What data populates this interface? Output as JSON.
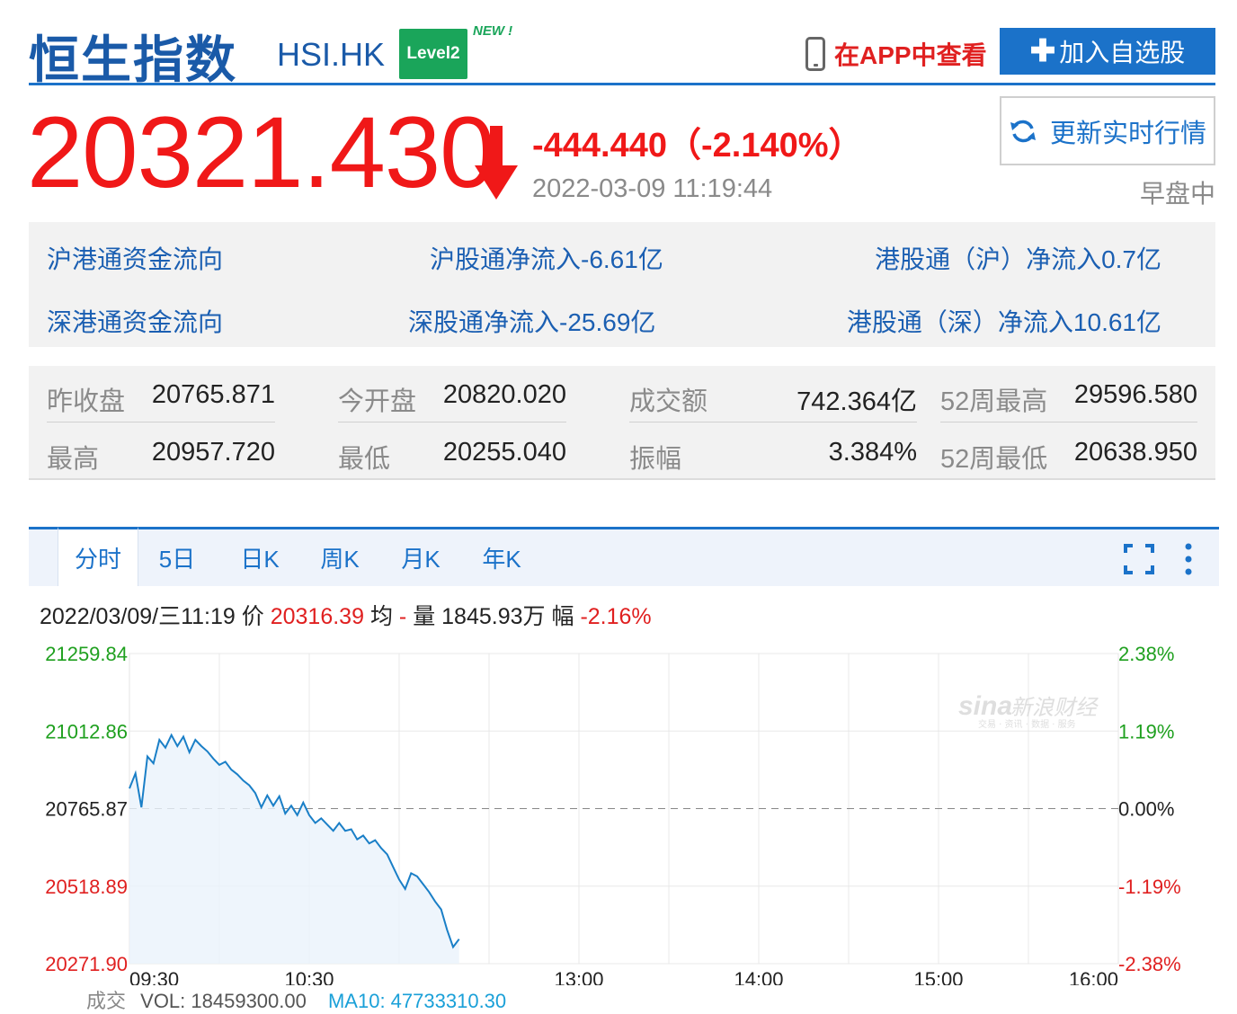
{
  "header": {
    "title": "恒生指数",
    "code": "HSI.HK",
    "level2_badge": "Level2",
    "new_tag": "NEW !",
    "app_link": "在APP中查看",
    "add_watchlist": "加入自选股",
    "add_symbol": "✚"
  },
  "quote": {
    "price": "20321.430",
    "change": "-444.440（-2.140%）",
    "datetime": "2022-03-09 11:19:44",
    "refresh": "更新实时行情",
    "session": "早盘中"
  },
  "flows": [
    {
      "a": "沪港通资金流向",
      "b": "沪股通净流入-6.61亿",
      "c": "港股通（沪）净流入0.7亿"
    },
    {
      "a": "深港通资金流向",
      "b": "深股通净流入-25.69亿",
      "c": "港股通（深）净流入10.61亿"
    }
  ],
  "stats": {
    "prev_close_label": "昨收盘",
    "prev_close": "20765.871",
    "open_label": "今开盘",
    "open": "20820.020",
    "turnover_label": "成交额",
    "turnover": "742.364亿",
    "w52_high_label": "52周最高",
    "w52_high": "29596.580",
    "high_label": "最高",
    "high": "20957.720",
    "low_label": "最低",
    "low": "20255.040",
    "amplitude_label": "振幅",
    "amplitude": "3.384%",
    "w52_low_label": "52周最低",
    "w52_low": "20638.950"
  },
  "tabs": [
    "分时",
    "5日",
    "日K",
    "周K",
    "月K",
    "年K"
  ],
  "info": {
    "date": "2022/03/09/三11:19",
    "price_label": "价",
    "price": "20316.39",
    "avg_label": "均",
    "avg": "-",
    "vol_label": "量",
    "vol": "1845.93万",
    "amp_label": "幅",
    "amp": "-2.16%"
  },
  "watermark": {
    "brand": "sina",
    "text": "新浪财经",
    "sub": "交易 · 资讯 · 数据 · 服务"
  },
  "volume_line": {
    "label": "成交",
    "vol": "VOL: 18459300.00",
    "ma10": "MA10: 47733310.30"
  },
  "colors": {
    "accent": "#1b72c9",
    "down": "#f01818",
    "up_axis": "#1fa01f",
    "line": "#1a7fc7"
  },
  "chart_data": {
    "type": "line",
    "y_left_ticks": [
      "21259.84",
      "21012.86",
      "20765.87",
      "20518.89",
      "20271.90"
    ],
    "y_right_ticks": [
      "2.38%",
      "1.19%",
      "0.00%",
      "-1.19%",
      "-2.38%"
    ],
    "ylim": [
      20271.9,
      21259.84
    ],
    "base": 20765.87,
    "x_ticks": [
      "09:30",
      "10:30",
      "13:00",
      "14:00",
      "15:00",
      "16:00"
    ],
    "series": [
      {
        "x": [
          0,
          2,
          4,
          6,
          8,
          10,
          12,
          14,
          16,
          18,
          20,
          22,
          24,
          26,
          28,
          30,
          32,
          34,
          36,
          38,
          40,
          42,
          44,
          46,
          48,
          50,
          52,
          54,
          56,
          58,
          60,
          62,
          64,
          66,
          68,
          70,
          72,
          74,
          76,
          78,
          80,
          82,
          84,
          86,
          88,
          90,
          92,
          94,
          96,
          98,
          100,
          102,
          104,
          106,
          108,
          110
        ],
        "values": [
          20830,
          20878,
          20770,
          20932,
          20910,
          20985,
          20960,
          21000,
          20965,
          20995,
          20945,
          20985,
          20965,
          20948,
          20925,
          20905,
          20915,
          20890,
          20875,
          20855,
          20840,
          20815,
          20770,
          20808,
          20775,
          20805,
          20750,
          20775,
          20745,
          20785,
          20745,
          20720,
          20735,
          20715,
          20695,
          20720,
          20695,
          20700,
          20668,
          20680,
          20655,
          20665,
          20640,
          20620,
          20580,
          20540,
          20510,
          20560,
          20550,
          20525,
          20500,
          20470,
          20445,
          20380,
          20325,
          20350
        ]
      }
    ]
  }
}
